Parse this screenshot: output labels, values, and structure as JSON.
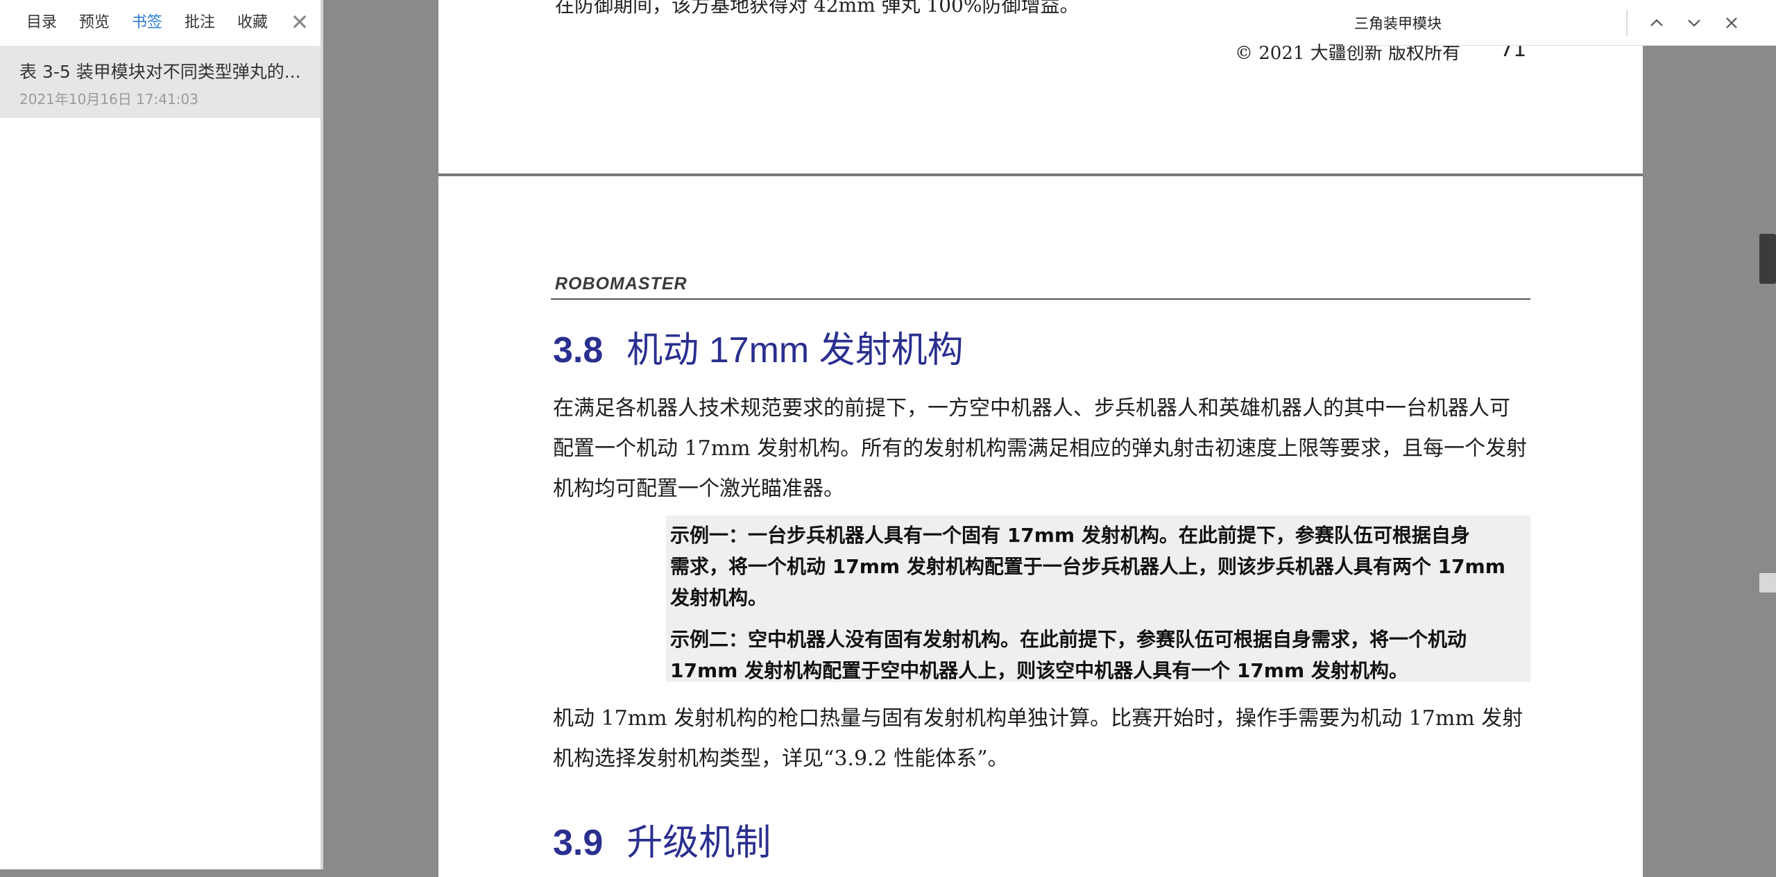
{
  "sidebar": {
    "tabs": [
      {
        "label": "目录"
      },
      {
        "label": "预览"
      },
      {
        "label": "书签"
      },
      {
        "label": "批注"
      },
      {
        "label": "收藏"
      }
    ],
    "close_symbol": "✕",
    "bookmark": {
      "title": "表 3-5 装甲模块对不同类型弹丸的...",
      "date": "2021年10月16日 17:41:03"
    }
  },
  "search": {
    "query": "三角装甲模块",
    "icons": [
      "chevron-up-icon",
      "chevron-down-icon",
      "close-icon"
    ]
  },
  "page1": {
    "cut_line": "在防御期间，该方基地获得对 42mm 弹丸 100%防御增益。",
    "footer_copy": "© 2021 大疆创新 版权所有",
    "footer_page": "71"
  },
  "page2": {
    "logo": "ROBOMASTER",
    "section1": {
      "number": "3.8",
      "title": "机动 17mm 发射机构"
    },
    "para1": [
      "在满足各机器人技术规范要求的前提下，一方空中机器人、步兵机器人和英雄机器人的其中一台机器人可",
      "配置一个机动 17mm 发射机构。所有的发射机构需满足相应的弹丸射击初速度上限等要求，且每一个发射",
      "机构均可配置一个激光瞄准器。"
    ],
    "examples": [
      "示例一：一台步兵机器人具有一个固有 17mm 发射机构。在此前提下，参赛队伍可根据自身",
      "需求，将一个机动 17mm 发射机构配置于一台步兵机器人上，则该步兵机器人具有两个 17mm",
      "发射机构。",
      "示例二：空中机器人没有固有发射机构。在此前提下，参赛队伍可根据自身需求，将一个机动",
      "17mm 发射机构配置于空中机器人上，则该空中机器人具有一个 17mm 发射机构。"
    ],
    "para2": [
      "机动 17mm 发射机构的枪口热量与固有发射机构单独计算。比赛开始时，操作手需要为机动 17mm 发射",
      "机构选择发射机构类型，详见“3.9.2 性能体系”。"
    ],
    "section2": {
      "number": "3.9",
      "title": "升级机制"
    }
  },
  "colors": {
    "heading": "#2a2f8f",
    "active_tab": "#2b7cd3",
    "viewer_bg": "#8a8a8a",
    "example_bg": "#efefef"
  }
}
